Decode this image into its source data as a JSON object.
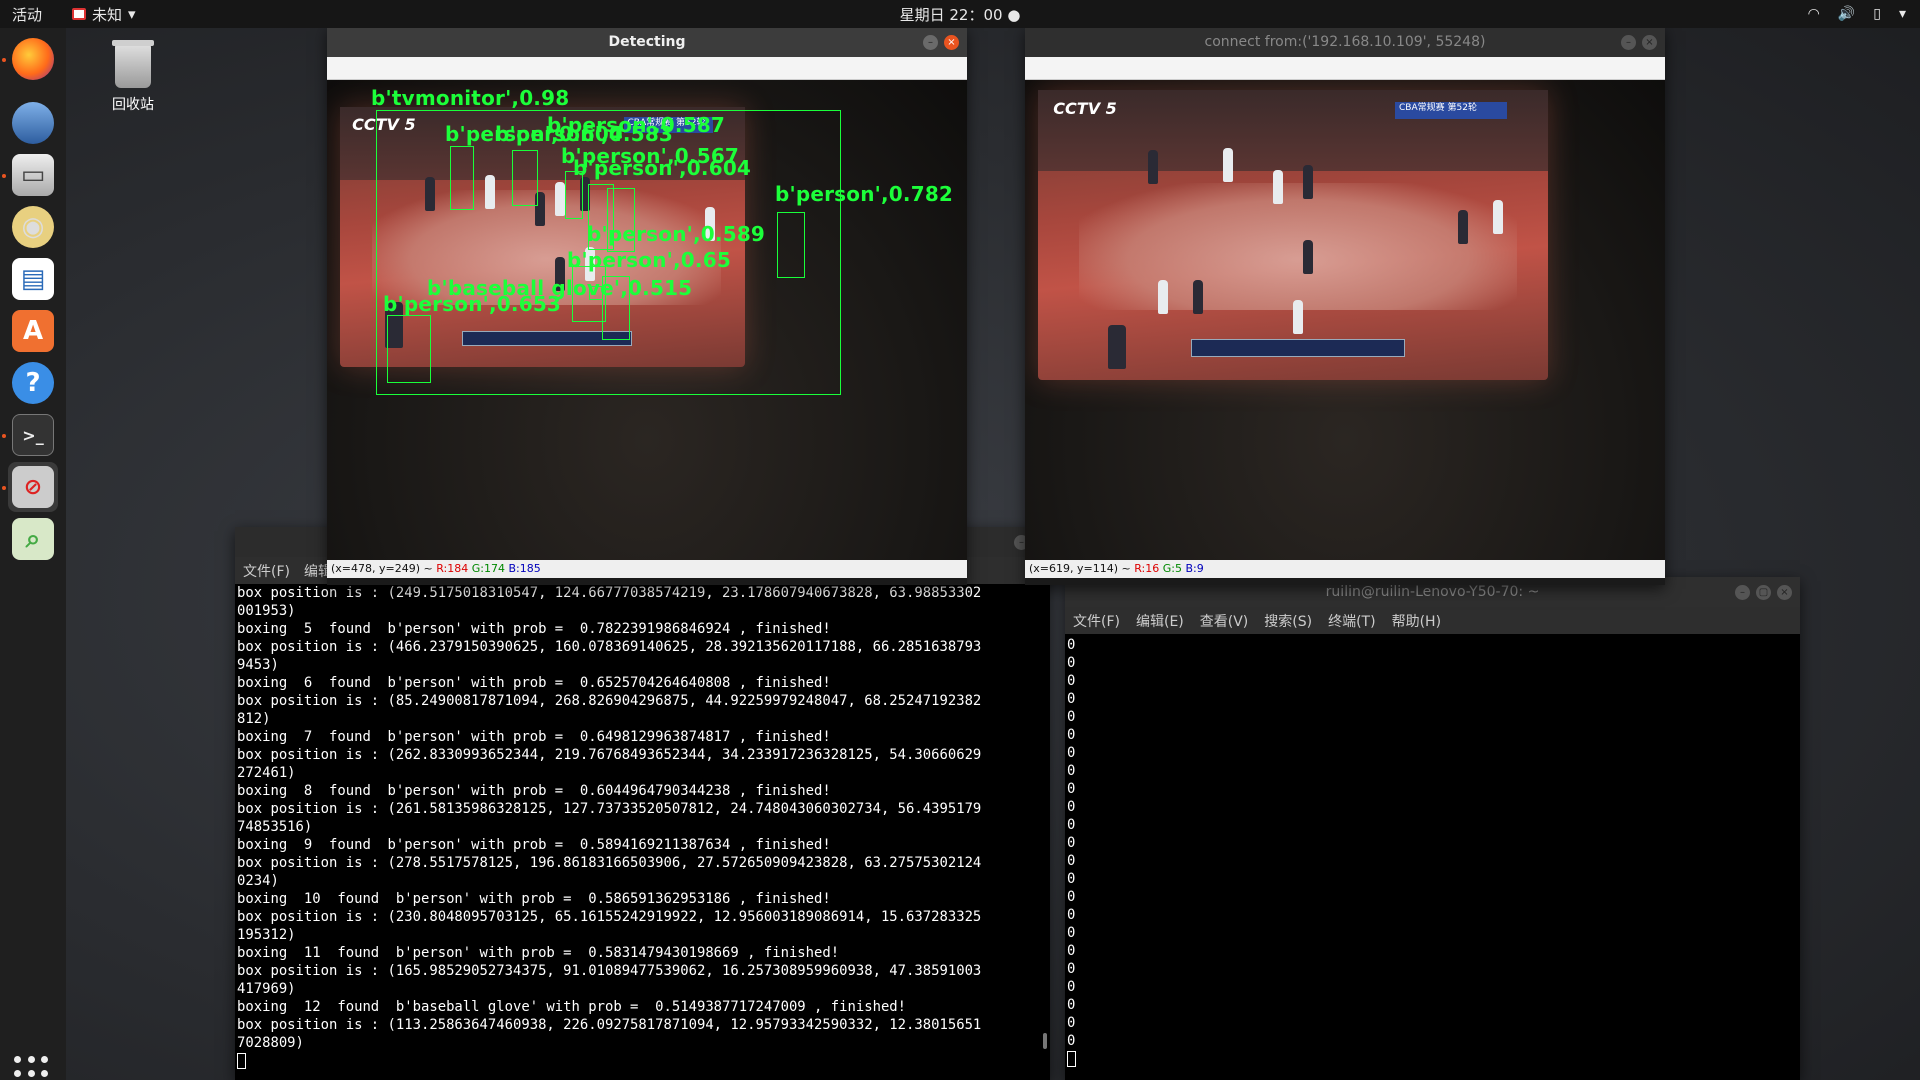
{
  "topbar": {
    "activities": "活动",
    "app_name": "未知",
    "clock": "星期日 22：00"
  },
  "desktop": {
    "trash_label": "回收站"
  },
  "dock": {
    "items": [
      "firefox-icon",
      "thunderbird-icon",
      "files-icon",
      "rhythmbox-icon",
      "libreoffice-writer-icon",
      "software-center-icon",
      "help-icon",
      "terminal-icon",
      "blocked-app-icon",
      "image-viewer-icon"
    ]
  },
  "detect_window": {
    "title": "Detecting",
    "status": {
      "coords": "(x=478, y=249) ~",
      "r": "R:184",
      "g": "G:174",
      "b": "B:185"
    },
    "tv_channel": "CCTV 5",
    "tv_tag": "CBA常规赛 第52轮",
    "labels": [
      "b'tvmonitor',0.98",
      "b'person',0.587",
      "b'person',0.604",
      "b'person',0.583",
      "b'person',0.567",
      "b'person',0.604",
      "b'person',0.782",
      "b'person',0.589",
      "b'person',0.65",
      "b'baseball glove',0.515",
      "b'person',0.653"
    ]
  },
  "connect_window": {
    "title": "connect from:('192.168.10.109', 55248)",
    "status": {
      "coords": "(x=619, y=114) ~",
      "r": "R:16",
      "g": "G:5",
      "b": "B:9"
    },
    "tv_channel": "CCTV 5",
    "tv_tag": "CBA常规赛 第52轮"
  },
  "left_terminal": {
    "menu": [
      "文件(F)",
      "编辑"
    ],
    "lines": [
      "box position is : (249.5175018310547, 124.66777038574219, 23.178607940673828, 63.98853302",
      "001953)",
      "boxing  5  found  b'person' with prob =  0.7822391986846924 , finished!",
      "box position is : (466.2379150390625, 160.078369140625, 28.392135620117188, 66.2851638793",
      "9453)",
      "boxing  6  found  b'person' with prob =  0.6525704264640808 , finished!",
      "box position is : (85.24900817871094, 268.826904296875, 44.92259979248047, 68.25247192382",
      "812)",
      "boxing  7  found  b'person' with prob =  0.6498129963874817 , finished!",
      "box position is : (262.8330993652344, 219.76768493652344, 34.233917236328125, 54.30660629",
      "272461)",
      "boxing  8  found  b'person' with prob =  0.6044964790344238 , finished!",
      "box position is : (261.58135986328125, 127.73733520507812, 24.748043060302734, 56.4395179",
      "74853516)",
      "boxing  9  found  b'person' with prob =  0.5894169211387634 , finished!",
      "box position is : (278.5517578125, 196.86183166503906, 27.572650909423828, 63.27575302124",
      "0234)",
      "boxing  10  found  b'person' with prob =  0.586591362953186 , finished!",
      "box position is : (230.8048095703125, 65.16155242919922, 12.956003189086914, 15.637283325",
      "195312)",
      "boxing  11  found  b'person' with prob =  0.5831479430198669 , finished!",
      "box position is : (165.98529052734375, 91.01089477539062, 16.257308959960938, 47.38591003",
      "417969)",
      "boxing  12  found  b'baseball glove' with prob =  0.5149387717247009 , finished!",
      "box position is : (113.25863647460938, 226.09275817871094, 12.95793342590332, 12.38015651",
      "7028809)"
    ]
  },
  "right_terminal": {
    "title": "ruilin@ruilin-Lenovo-Y50-70: ~",
    "menu": [
      "文件(F)",
      "编辑(E)",
      "查看(V)",
      "搜索(S)",
      "终端(T)",
      "帮助(H)"
    ],
    "lines": [
      "0",
      "0",
      "0",
      "0",
      "0",
      "0",
      "0",
      "0",
      "0",
      "0",
      "0",
      "0",
      "0",
      "0",
      "0",
      "0",
      "0",
      "0",
      "0",
      "0",
      "0",
      "0",
      "0"
    ]
  }
}
